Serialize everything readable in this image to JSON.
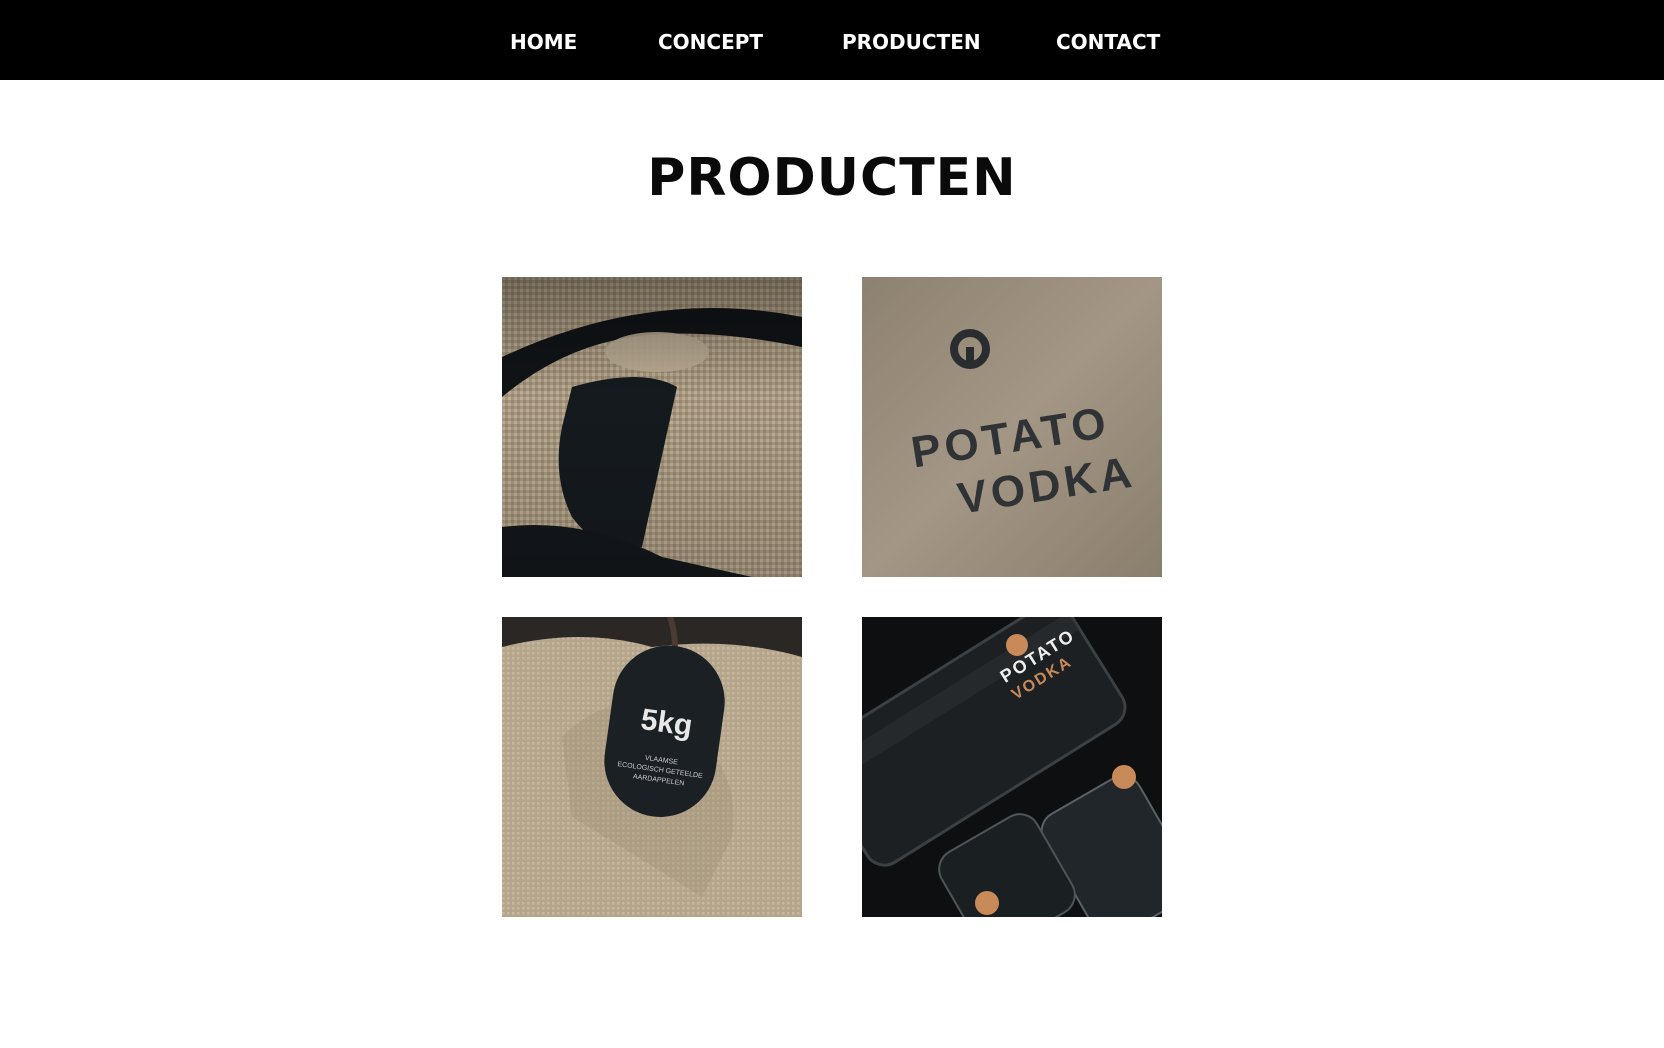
{
  "nav": {
    "items": [
      {
        "label": "HOME"
      },
      {
        "label": "CONCEPT"
      },
      {
        "label": "PRODUCTEN"
      },
      {
        "label": "CONTACT"
      }
    ]
  },
  "main": {
    "title": "PRODUCTEN"
  },
  "products": [
    {
      "photo": "burlap-logo-closeup",
      "text": ""
    },
    {
      "photo": "potato-vodka-stamp",
      "text_line1": "POTATO",
      "text_line2": "VODKA"
    },
    {
      "photo": "burlap-sack-tag",
      "tag_weight": "5kg",
      "tag_line1": "VLAAMSE",
      "tag_line2": "ECOLOGISCH GETEELDE",
      "tag_line3": "AARDAPPELEN"
    },
    {
      "photo": "vodka-bottle-glasses",
      "label_line1": "POTATO",
      "label_line2": "VODKA"
    }
  ],
  "colors": {
    "nav_bg": "#000000",
    "nav_text": "#ffffff",
    "title": "#0a0a0a",
    "copper": "#c98a5a"
  }
}
